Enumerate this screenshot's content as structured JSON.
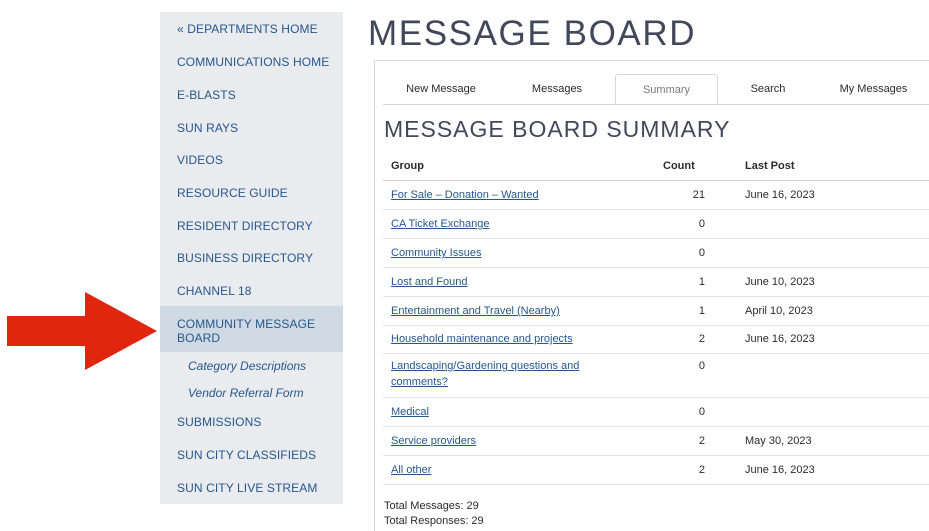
{
  "sidebar": {
    "items": [
      {
        "label": "« DEPARTMENTS HOME"
      },
      {
        "label": "COMMUNICATIONS HOME"
      },
      {
        "label": "E-BLASTS"
      },
      {
        "label": "SUN RAYS"
      },
      {
        "label": "VIDEOS"
      },
      {
        "label": "RESOURCE GUIDE"
      },
      {
        "label": "RESIDENT DIRECTORY"
      },
      {
        "label": "BUSINESS DIRECTORY"
      },
      {
        "label": "CHANNEL 18"
      },
      {
        "label": "COMMUNITY MESSAGE BOARD"
      },
      {
        "label": "SUBMISSIONS"
      },
      {
        "label": "SUN CITY CLASSIFIEDS"
      },
      {
        "label": "SUN CITY LIVE STREAM"
      }
    ],
    "sub_items": [
      {
        "label": "Category Descriptions"
      },
      {
        "label": "Vendor Referral Form"
      }
    ],
    "active_index": 9
  },
  "main": {
    "title": "MESSAGE BOARD",
    "tabs": [
      {
        "label": "New Message"
      },
      {
        "label": "Messages"
      },
      {
        "label": "Summary"
      },
      {
        "label": "Search"
      },
      {
        "label": "My Messages"
      }
    ],
    "active_tab": 2,
    "subtitle": "MESSAGE BOARD SUMMARY",
    "columns": {
      "group": "Group",
      "count": "Count",
      "last_post": "Last Post"
    },
    "rows": [
      {
        "group": "For Sale – Donation – Wanted",
        "count": "21",
        "last_post": "June 16, 2023"
      },
      {
        "group": "CA Ticket Exchange",
        "count": "0",
        "last_post": ""
      },
      {
        "group": "Community Issues",
        "count": "0",
        "last_post": ""
      },
      {
        "group": "Lost and Found",
        "count": "1",
        "last_post": "June 10, 2023"
      },
      {
        "group": "Entertainment and Travel (Nearby)",
        "count": "1",
        "last_post": "April 10, 2023"
      },
      {
        "group": "Household maintenance and projects",
        "count": "2",
        "last_post": "June 16, 2023"
      },
      {
        "group": "Landscaping/Gardening questions and comments?",
        "count": "0",
        "last_post": ""
      },
      {
        "group": "Medical",
        "count": "0",
        "last_post": ""
      },
      {
        "group": "Service providers",
        "count": "2",
        "last_post": "May 30, 2023"
      },
      {
        "group": "All other",
        "count": "2",
        "last_post": "June 16, 2023"
      }
    ],
    "totals": {
      "messages": "Total Messages: 29",
      "responses": "Total Responses: 29"
    }
  },
  "colors": {
    "arrow": "#e0260f",
    "link": "#24588f",
    "sidebar_bg": "#e9ebee",
    "sidebar_active_bg": "#cfd9e3"
  },
  "icons": {
    "pointer_arrow": "red-arrow-icon"
  }
}
